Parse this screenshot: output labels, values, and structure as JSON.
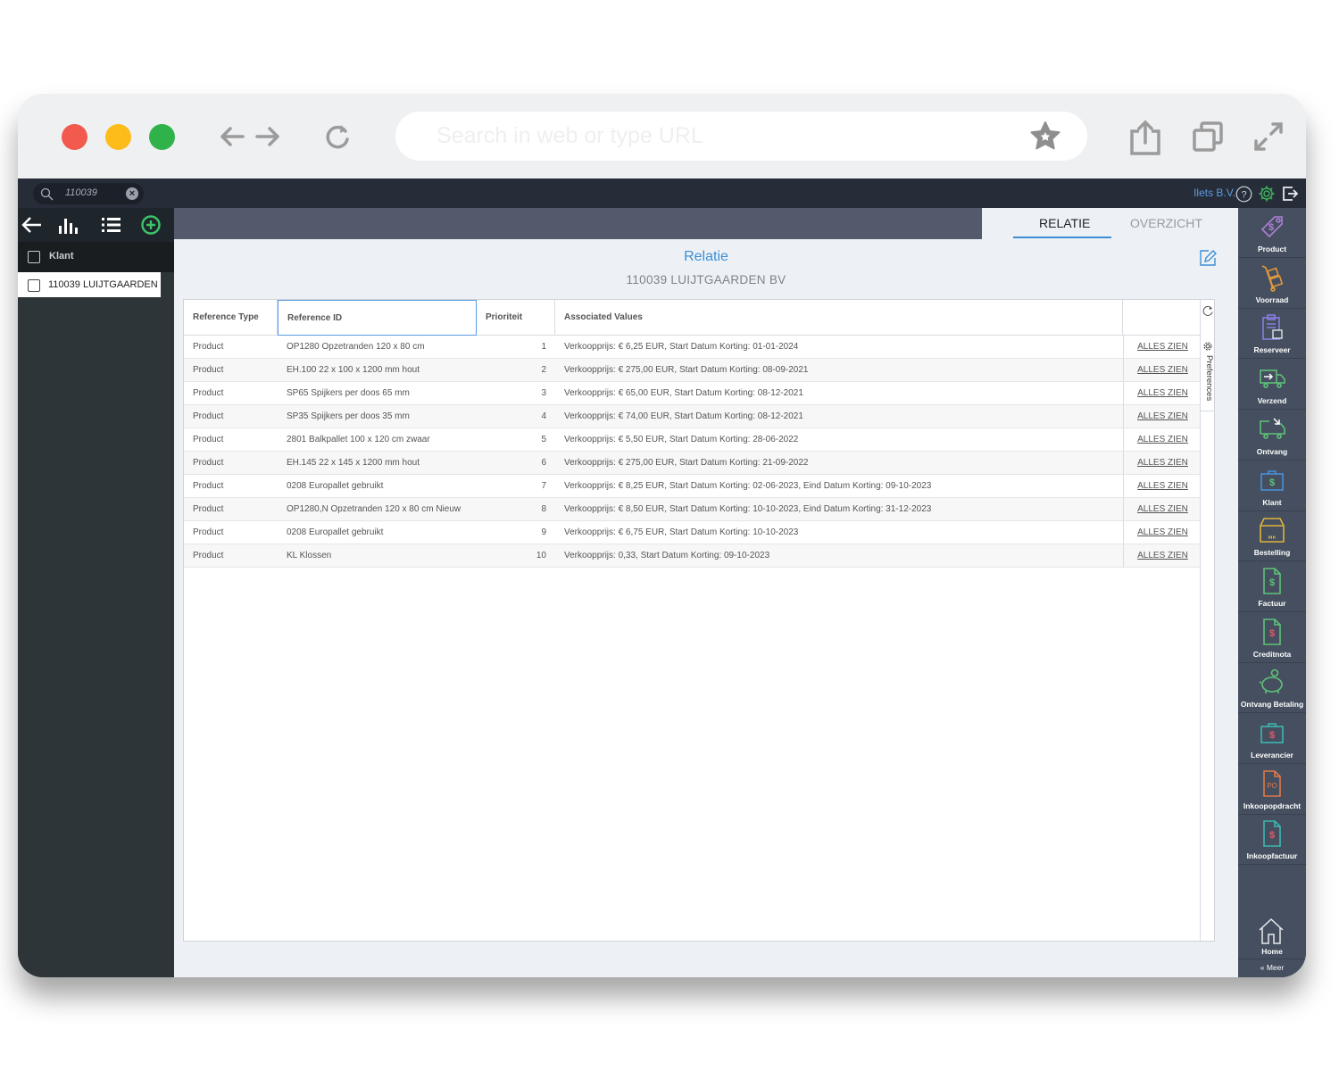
{
  "browser": {
    "url_placeholder": "Search in web or type URL",
    "url_value": "",
    "icons": [
      "back-arrow-icon",
      "forward-arrow-icon",
      "reload-icon",
      "star-icon",
      "share-icon",
      "tabs-icon",
      "fullscreen-icon"
    ]
  },
  "topbar": {
    "search_value": "110039",
    "company": "Ilets B.V.",
    "icons": [
      "search-icon",
      "clear-icon",
      "help-icon",
      "gear-icon",
      "logout-icon"
    ]
  },
  "left_panel": {
    "toolbar_icons": [
      "back-arrow-icon",
      "bar-chart-icon",
      "list-icon",
      "add-circle-icon"
    ],
    "header_label": "Klant",
    "items": [
      {
        "label": "110039 LUIJTGAARDEN BV"
      }
    ]
  },
  "tabs": [
    {
      "label": "RELATIE",
      "active": true
    },
    {
      "label": "OVERZICHT",
      "active": false
    }
  ],
  "header": {
    "title": "Relatie",
    "subtitle": "110039 LUIJTGAARDEN BV"
  },
  "grid": {
    "columns": [
      "Reference Type",
      "Reference ID",
      "Prioriteit",
      "Associated Values",
      ""
    ],
    "link_label": "ALLES ZIEN",
    "preferences_label": "Preferences",
    "rows": [
      {
        "type": "Product",
        "ref_id": "OP1280 Opzetranden 120 x 80 cm",
        "priority": "1",
        "values": "Verkoopprijs: € 6,25 EUR, Start Datum Korting: 01-01-2024"
      },
      {
        "type": "Product",
        "ref_id": "EH.100 22 x 100 x 1200 mm hout",
        "priority": "2",
        "values": "Verkoopprijs: € 275,00 EUR, Start Datum Korting: 08-09-2021"
      },
      {
        "type": "Product",
        "ref_id": "SP65 Spijkers per doos 65 mm",
        "priority": "3",
        "values": "Verkoopprijs: € 65,00 EUR, Start Datum Korting: 08-12-2021"
      },
      {
        "type": "Product",
        "ref_id": "SP35 Spijkers per doos 35 mm",
        "priority": "4",
        "values": "Verkoopprijs: € 74,00 EUR, Start Datum Korting: 08-12-2021"
      },
      {
        "type": "Product",
        "ref_id": "2801 Balkpallet 100 x 120 cm zwaar",
        "priority": "5",
        "values": "Verkoopprijs: € 5,50 EUR, Start Datum Korting: 28-06-2022"
      },
      {
        "type": "Product",
        "ref_id": "EH.145 22 x 145 x 1200 mm hout",
        "priority": "6",
        "values": "Verkoopprijs: € 275,00 EUR, Start Datum Korting: 21-09-2022"
      },
      {
        "type": "Product",
        "ref_id": "0208 Europallet gebruikt",
        "priority": "7",
        "values": "Verkoopprijs: € 8,25 EUR, Start Datum Korting: 02-06-2023, Eind Datum Korting: 09-10-2023"
      },
      {
        "type": "Product",
        "ref_id": "OP1280,N Opzetranden 120 x 80 cm Nieuw",
        "priority": "8",
        "values": "Verkoopprijs: € 8,50 EUR, Start Datum Korting: 10-10-2023, Eind Datum Korting: 31-12-2023"
      },
      {
        "type": "Product",
        "ref_id": "0208 Europallet gebruikt",
        "priority": "9",
        "values": "Verkoopprijs: € 6,75 EUR, Start Datum Korting: 10-10-2023"
      },
      {
        "type": "Product",
        "ref_id": "KL Klossen",
        "priority": "10",
        "values": "Verkoopprijs: 0,33, Start Datum Korting: 09-10-2023"
      }
    ]
  },
  "right_nav": {
    "items": [
      {
        "label": "Product",
        "icon": "price-tag-icon",
        "color": "#b07fd6"
      },
      {
        "label": "Voorraad",
        "icon": "hand-truck-icon",
        "color": "#e09a3c"
      },
      {
        "label": "Reserveer",
        "icon": "clipboard-box-icon",
        "color": "#8a7fe0"
      },
      {
        "label": "Verzend",
        "icon": "truck-send-icon",
        "color": "#5ec27a"
      },
      {
        "label": "Ontvang",
        "icon": "truck-receive-icon",
        "color": "#5ec27a"
      },
      {
        "label": "Klant",
        "icon": "briefcase-dollar-icon",
        "color": "#4a90d9"
      },
      {
        "label": "Bestelling",
        "icon": "box-icon",
        "color": "#e0b23c"
      },
      {
        "label": "Factuur",
        "icon": "invoice-dollar-icon",
        "color": "#5ec27a"
      },
      {
        "label": "Creditnota",
        "icon": "credit-note-icon",
        "color": "#5ec27a"
      },
      {
        "label": "Ontvang Betaling",
        "icon": "piggy-bank-icon",
        "color": "#5ec27a"
      },
      {
        "label": "Leverancier",
        "icon": "supplier-briefcase-icon",
        "color": "#3cb8b0"
      },
      {
        "label": "Inkoopopdracht",
        "icon": "purchase-order-icon",
        "color": "#e0784a"
      },
      {
        "label": "Inkoopfactuur",
        "icon": "purchase-invoice-icon",
        "color": "#3cb8b0"
      }
    ],
    "home_label": "Home",
    "more_label": "« Meer"
  }
}
